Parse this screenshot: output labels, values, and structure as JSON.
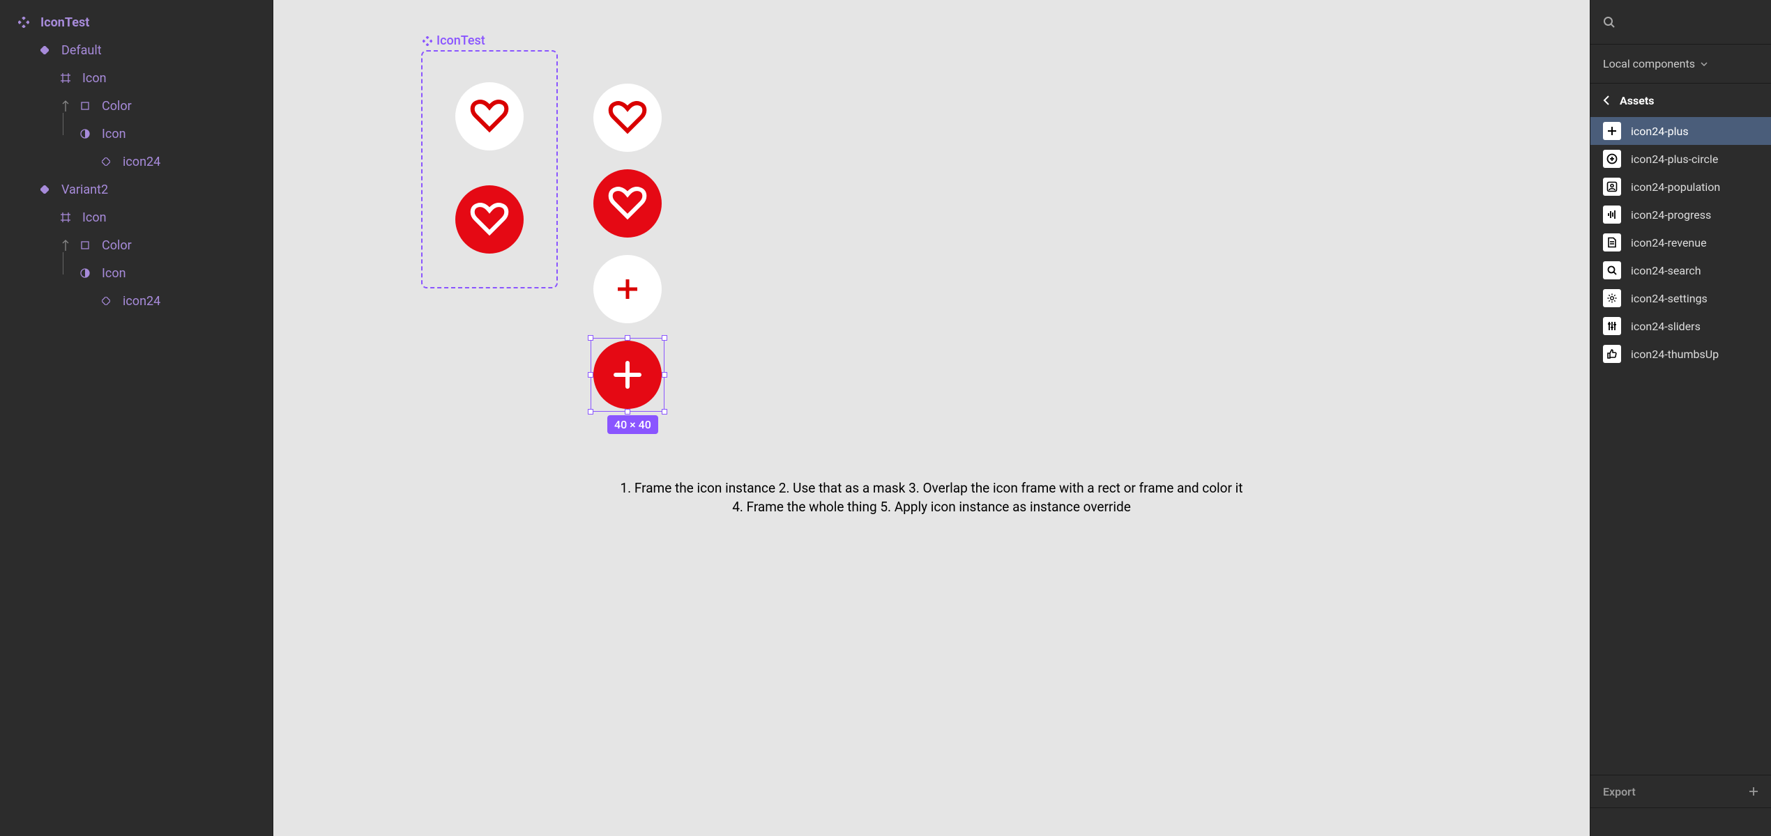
{
  "leftPanel": {
    "root": "IconTest",
    "variants": [
      {
        "name": "Default",
        "children": [
          {
            "label": "Icon",
            "glyph": "frame"
          },
          {
            "label": "Color",
            "glyph": "square",
            "arrow": true
          },
          {
            "label": "Icon",
            "glyph": "mask"
          },
          {
            "label": "icon24",
            "glyph": "instance"
          }
        ]
      },
      {
        "name": "Variant2",
        "children": [
          {
            "label": "Icon",
            "glyph": "frame"
          },
          {
            "label": "Color",
            "glyph": "square",
            "arrow": true
          },
          {
            "label": "Icon",
            "glyph": "mask"
          },
          {
            "label": "icon24",
            "glyph": "instance"
          }
        ]
      }
    ]
  },
  "canvas": {
    "componentLabel": "IconTest",
    "selectionDimensions": "40 × 40",
    "noteLine1": "1. Frame the icon instance 2. Use that as a mask 3. Overlap the icon frame with a rect or frame and color it",
    "noteLine2": "4. Frame the whole thing 5. Apply icon instance as instance override"
  },
  "rightPanel": {
    "dropdown": "Local components",
    "assetsHeader": "Assets",
    "selectedAsset": "icon24-plus",
    "assets": [
      {
        "id": "icon24-plus",
        "icon": "plus"
      },
      {
        "id": "icon24-plus-circle",
        "icon": "plus-circle"
      },
      {
        "id": "icon24-population",
        "icon": "user-square"
      },
      {
        "id": "icon24-progress",
        "icon": "waveform"
      },
      {
        "id": "icon24-revenue",
        "icon": "document"
      },
      {
        "id": "icon24-search",
        "icon": "search"
      },
      {
        "id": "icon24-settings",
        "icon": "gear"
      },
      {
        "id": "icon24-sliders",
        "icon": "sliders"
      },
      {
        "id": "icon24-thumbsUp",
        "icon": "thumbs-up"
      }
    ],
    "export": "Export"
  }
}
